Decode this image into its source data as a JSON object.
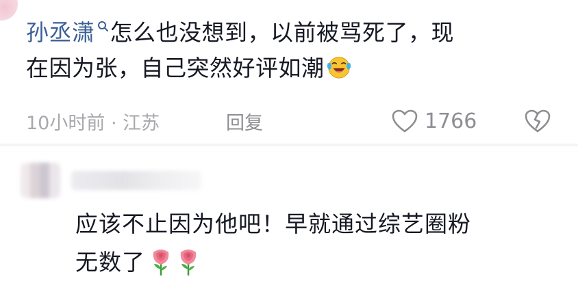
{
  "comment_top": {
    "username": "孙丞潇",
    "search_icon": "search-icon",
    "text_line1": "怎么也没想到，以前被骂死了，现",
    "text_line2": "在因为张，自己突然好评如潮",
    "emoji": "laughing-crying-emoji",
    "time_location": "10小时前 · 江苏",
    "reply_label": "回复",
    "like_icon": "heart-outline-icon",
    "like_count": "1766",
    "dislike_icon": "broken-heart-icon"
  },
  "comment_reply": {
    "avatar": "blurred-avatar",
    "username_redacted": true,
    "text_line1": "应该不止因为他吧！早就通过综艺圈粉",
    "text_line2": "无数了",
    "emojis": [
      "rose-icon",
      "rose-icon"
    ]
  },
  "colors": {
    "username": "#3b5f96",
    "text": "#161823",
    "meta": "#a8a8ad",
    "icon_stroke": "#8d8d92"
  }
}
